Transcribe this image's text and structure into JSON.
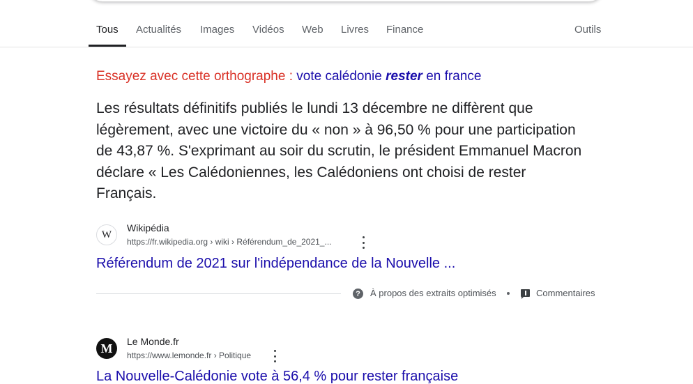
{
  "tabs": {
    "items": [
      {
        "label": "Tous",
        "active": true
      },
      {
        "label": "Actualités"
      },
      {
        "label": "Images"
      },
      {
        "label": "Vidéos"
      },
      {
        "label": "Web"
      },
      {
        "label": "Livres"
      },
      {
        "label": "Finance"
      }
    ],
    "tools_label": "Outils"
  },
  "spelling": {
    "lead": "Essayez avec cette orthographe :",
    "suggestion_before": "vote calédonie",
    "suggestion_bold": "rester",
    "suggestion_after": "en france"
  },
  "featured_snippet": {
    "text": "Les résultats définitifs publiés le lundi 13 décembre ne diffèrent que légèrement, avec une victoire du « non » à 96,50 % pour une participation de 43,87 %. S'exprimant au soir du scrutin, le président Emmanuel Macron déclare « Les Calédoniennes, les Calédoniens ont choisi de rester Français.",
    "source": {
      "favicon_letter": "W",
      "site_name": "Wikipédia",
      "url": "https://fr.wikipedia.org › wiki › Référendum_de_2021_...",
      "title": "Référendum de 2021 sur l'indépendance de la Nouvelle ..."
    },
    "about_label": "À propos des extraits optimisés",
    "separator": "•",
    "feedback_label": "Commentaires"
  },
  "results": [
    {
      "favicon_letter": "M",
      "site_name": "Le Monde.fr",
      "url": "https://www.lemonde.fr › Politique",
      "title": "La Nouvelle-Calédonie vote à 56,4 % pour rester française"
    }
  ],
  "colors": {
    "link": "#1a0dab",
    "spell_lead": "#d93025",
    "text": "#202124",
    "secondary": "#5f6368"
  },
  "icons": {
    "help": "question-circle-icon",
    "feedback": "feedback-icon",
    "more": "more-vert-icon"
  }
}
